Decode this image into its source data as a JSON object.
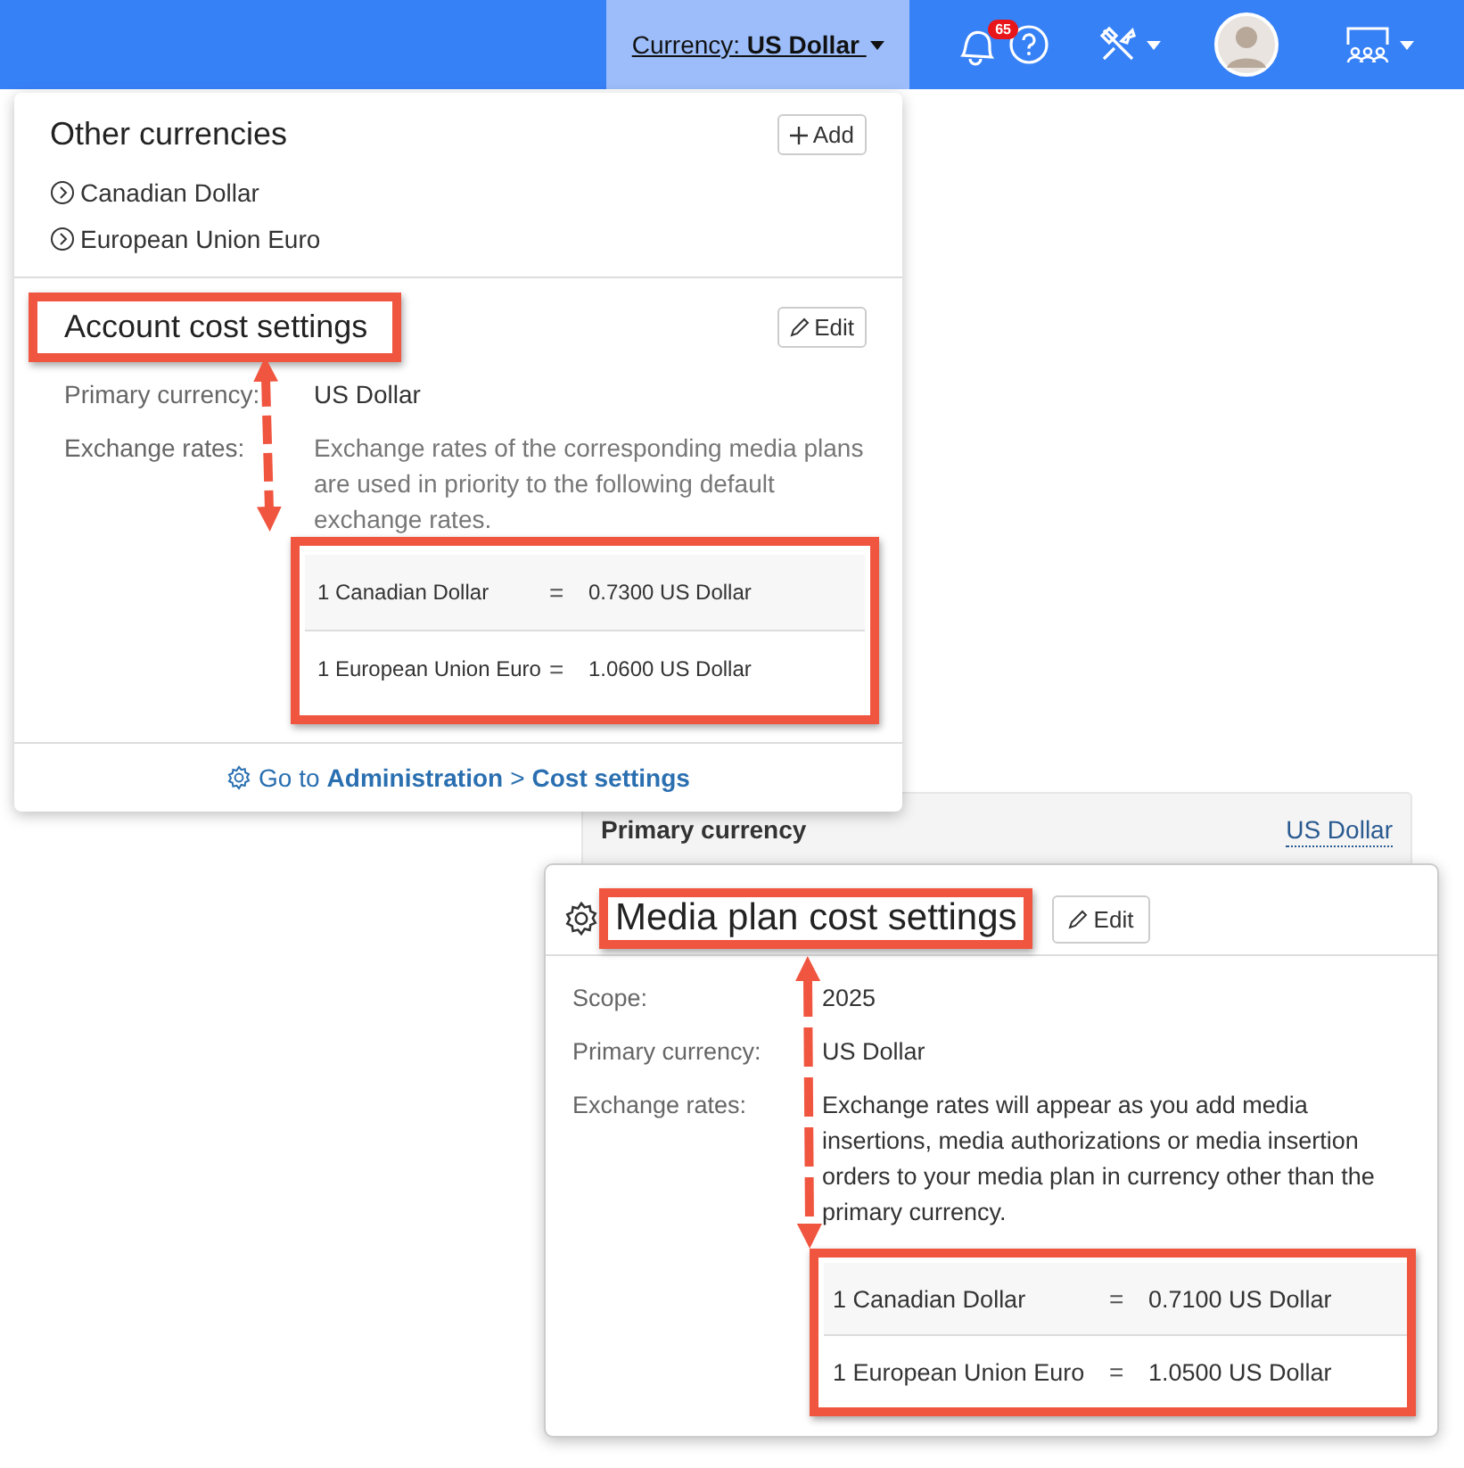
{
  "top_bar": {
    "currency_label": "Currency:",
    "currency_value": "US Dollar",
    "notification_count": "65"
  },
  "account_popover": {
    "other_title": "Other currencies",
    "add_button": "Add",
    "currencies": [
      "Canadian Dollar",
      "European Union Euro"
    ],
    "title": "Account cost settings",
    "edit_button": "Edit",
    "fields": [
      {
        "label": "Primary currency:",
        "value": "US Dollar"
      },
      {
        "label": "Exchange rates:",
        "value": "Exchange rates of the corresponding media plans are used in priority to the following default exchange rates."
      }
    ],
    "rates": [
      {
        "from": "1 Canadian Dollar",
        "equals": "=",
        "to": "0.7300 US Dollar"
      },
      {
        "from": "1 European Union Euro",
        "equals": "=",
        "to": "1.0600 US Dollar"
      }
    ],
    "footer": {
      "prefix": "Go to",
      "link": "Administration",
      "separator": ">",
      "link_2": "Cost settings"
    }
  },
  "panel": {
    "label": "Primary currency",
    "value": "US Dollar"
  },
  "media_popover": {
    "title": "Media plan cost settings",
    "edit_button": "Edit",
    "fields": [
      {
        "label": "Scope:",
        "value": "2025"
      },
      {
        "label": "Primary currency:",
        "value": "US Dollar"
      },
      {
        "label": "Exchange rates:",
        "value": "Exchange rates will appear as you add media insertions, media authorizations or media insertion orders to your media plan in currency other than the primary currency."
      }
    ],
    "rates": [
      {
        "from": "1 Canadian Dollar",
        "equals": "=",
        "to": "0.7100 US Dollar"
      },
      {
        "from": "1 European Union Euro",
        "equals": "=",
        "to": "1.0500 US Dollar"
      }
    ]
  }
}
